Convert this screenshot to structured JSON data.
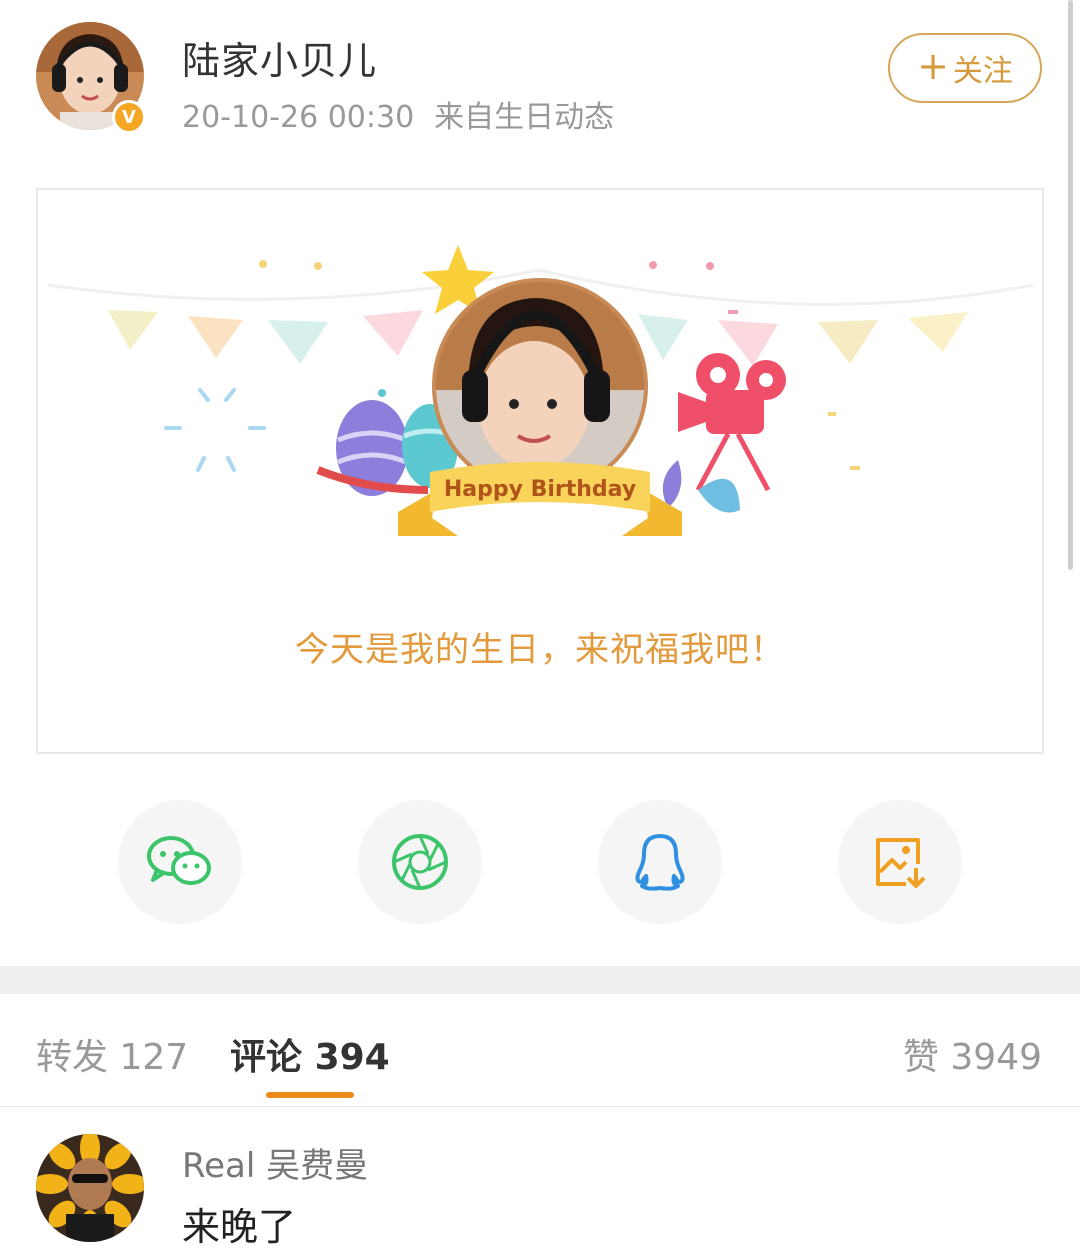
{
  "post": {
    "username": "陆家小贝儿",
    "timestamp": "20-10-26 00:30",
    "source": "来自生日动态",
    "follow_label": "关注"
  },
  "card": {
    "banner_text": "Happy Birthday",
    "message": "今天是我的生日，来祝福我吧！"
  },
  "share": {
    "items": [
      "wechat-icon",
      "moments-icon",
      "qq-icon",
      "save-image-icon"
    ]
  },
  "tabs": {
    "repost_label": "转发",
    "repost_count": "127",
    "comment_label": "评论",
    "comment_count": "394",
    "like_label": "赞",
    "like_count": "3949"
  },
  "comments": [
    {
      "name": "Real 吴费曼",
      "text": "来晚了"
    }
  ],
  "colors": {
    "accent": "#ef8b1a",
    "follow": "#d59a3e",
    "share_icon_green": "#3cc46a",
    "share_icon_blue": "#2f8fe0",
    "share_icon_orange": "#f0a020"
  }
}
